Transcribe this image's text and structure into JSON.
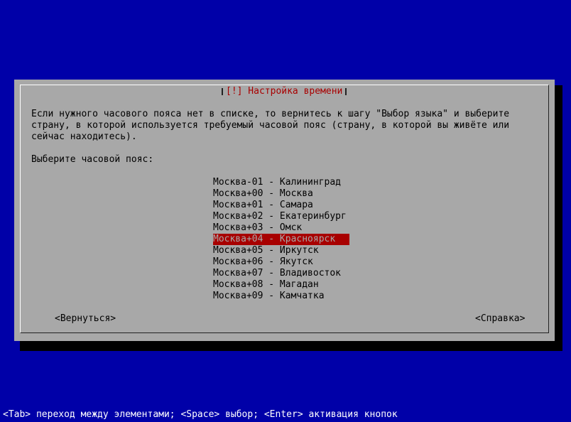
{
  "dialog": {
    "title": "[!] Настройка времени",
    "intro": "Если нужного часового пояса нет в списке, то вернитесь к шагу \"Выбор языка\" и выберите\nстрану, в которой используется требуемый часовой пояс (страну, в которой вы живёте или\nсейчас находитесь).",
    "prompt": "Выберите часовой пояс:",
    "timezones": [
      "Москва-01 - Калининград",
      "Москва+00 - Москва",
      "Москва+01 - Самара",
      "Москва+02 - Екатеринбург",
      "Москва+03 - Омск",
      "Москва+04 - Красноярск",
      "Москва+05 - Иркутск",
      "Москва+06 - Якутск",
      "Москва+07 - Владивосток",
      "Москва+08 - Магадан",
      "Москва+09 - Камчатка"
    ],
    "selected_index": 5,
    "back_label": "<Вернуться>",
    "help_label": "<Справка>"
  },
  "status_bar": "<Tab> переход между элементами; <Space> выбор; <Enter> активация кнопок",
  "colors": {
    "background": "#0000a8",
    "dialog": "#a8a8a8",
    "title": "#a80000",
    "selection": "#a80000",
    "status_text": "#ffffff"
  }
}
